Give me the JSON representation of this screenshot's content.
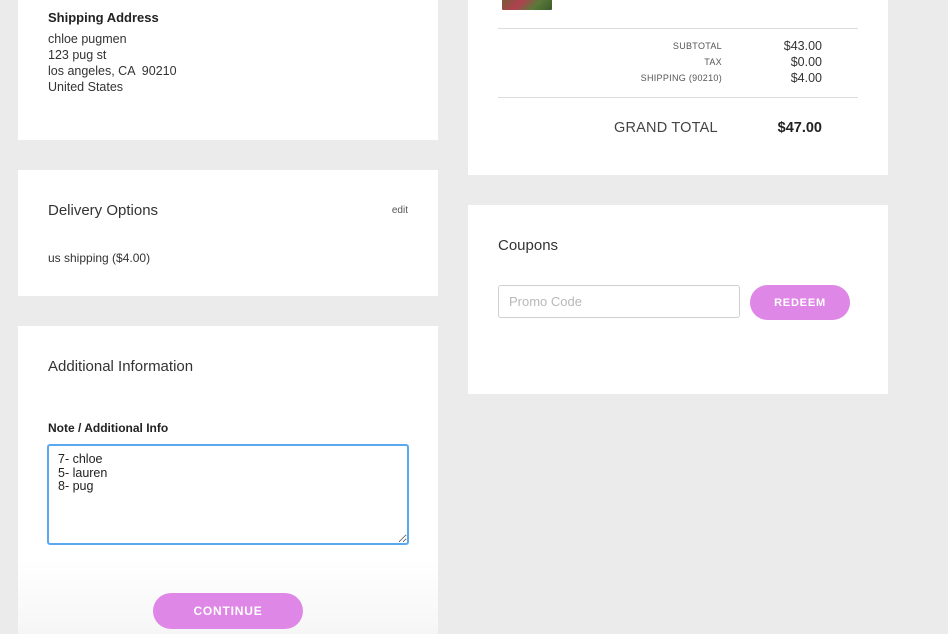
{
  "shipping_address": {
    "title": "Shipping Address",
    "name": "chloe pugmen",
    "street": "123 pug st",
    "city_line": "los angeles, CA  90210",
    "country": "United States"
  },
  "delivery_options": {
    "title": "Delivery Options",
    "edit_label": "edit",
    "selected": "us shipping ($4.00)"
  },
  "additional_info": {
    "title": "Additional Information",
    "note_label": "Note / Additional Info",
    "note_value": "7- chloe\n5- lauren\n8- pug",
    "continue_label": "CONTINUE"
  },
  "order_summary": {
    "subtotal_label": "SUBTOTAL",
    "subtotal_value": "$43.00",
    "tax_label": "TAX",
    "tax_value": "$0.00",
    "shipping_label": "SHIPPING (90210)",
    "shipping_value": "$4.00",
    "grand_total_label": "GRAND TOTAL",
    "grand_total_value": "$47.00"
  },
  "coupons": {
    "title": "Coupons",
    "promo_placeholder": "Promo Code",
    "redeem_label": "REDEEM"
  },
  "colors": {
    "page_background": "#ebebeb",
    "card_background": "#ffffff",
    "accent_button": "#df87e6",
    "focus_border": "#5aa8ee"
  }
}
